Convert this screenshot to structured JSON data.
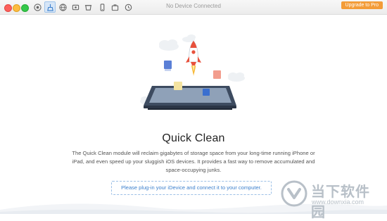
{
  "window": {
    "title": "No Device Connected",
    "upgrade_label": "Upgrade to Pro"
  },
  "toolbar": {
    "items": [
      {
        "icon": "wifi-icon"
      },
      {
        "icon": "quick-clean-icon",
        "active": true
      },
      {
        "icon": "globe-icon"
      },
      {
        "icon": "photo-icon"
      },
      {
        "icon": "bucket-icon"
      },
      {
        "icon": "phone-icon"
      },
      {
        "icon": "briefcase-icon"
      },
      {
        "icon": "history-icon"
      }
    ]
  },
  "main": {
    "title": "Quick Clean",
    "description": "The Quick Clean module will reclaim gigabytes of storage space from your long-time running iPhone or iPad, and even speed up your sluggish iOS devices. It provides a fast way to remove accumulated and space-occupying junks.",
    "connect_prompt": "Please plug-in your iDevice and connect it to your computer."
  },
  "watermark": {
    "brand": "当下软件园",
    "url": "www.downxia.com"
  },
  "colors": {
    "accent": "#f39c38",
    "link": "#3b7fcc"
  }
}
